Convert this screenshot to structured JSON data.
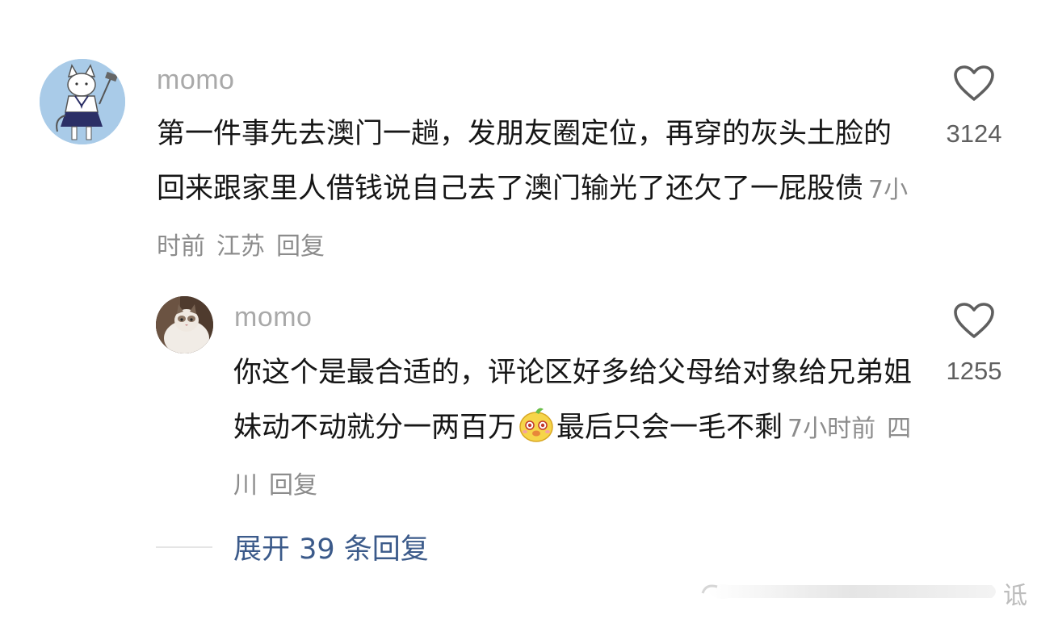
{
  "comments": [
    {
      "username": "momo",
      "text": "第一件事先去澳门一趟，发朋友圈定位，再穿的灰头土脸的回来跟家里人借钱说自己去了澳门输光了还欠了一屁股债",
      "time": "7小时前",
      "location": "江苏",
      "reply_label": "回复",
      "like_count": "3124",
      "avatar_icon": "cat-schoolgirl-avatar"
    },
    {
      "username": "momo",
      "text_before_emoji": "你这个是最合适的，评论区好多给父母给对象给兄弟姐妹动不动就分一两百万",
      "emoji": "smiling-face-sticker-icon",
      "text_after_emoji": "最后只会一毛不剩",
      "time": "7小时前",
      "location": "四川",
      "reply_label": "回复",
      "like_count": "1255",
      "avatar_icon": "ragdoll-cat-avatar"
    }
  ],
  "expand_replies": "展开 39 条回复",
  "watermark_text": "诋",
  "colors": {
    "username": "#a9a9a9",
    "body": "#161616",
    "meta": "#8c8c8c",
    "link": "#3b5a8a",
    "like_icon": "#5f5f5f"
  }
}
